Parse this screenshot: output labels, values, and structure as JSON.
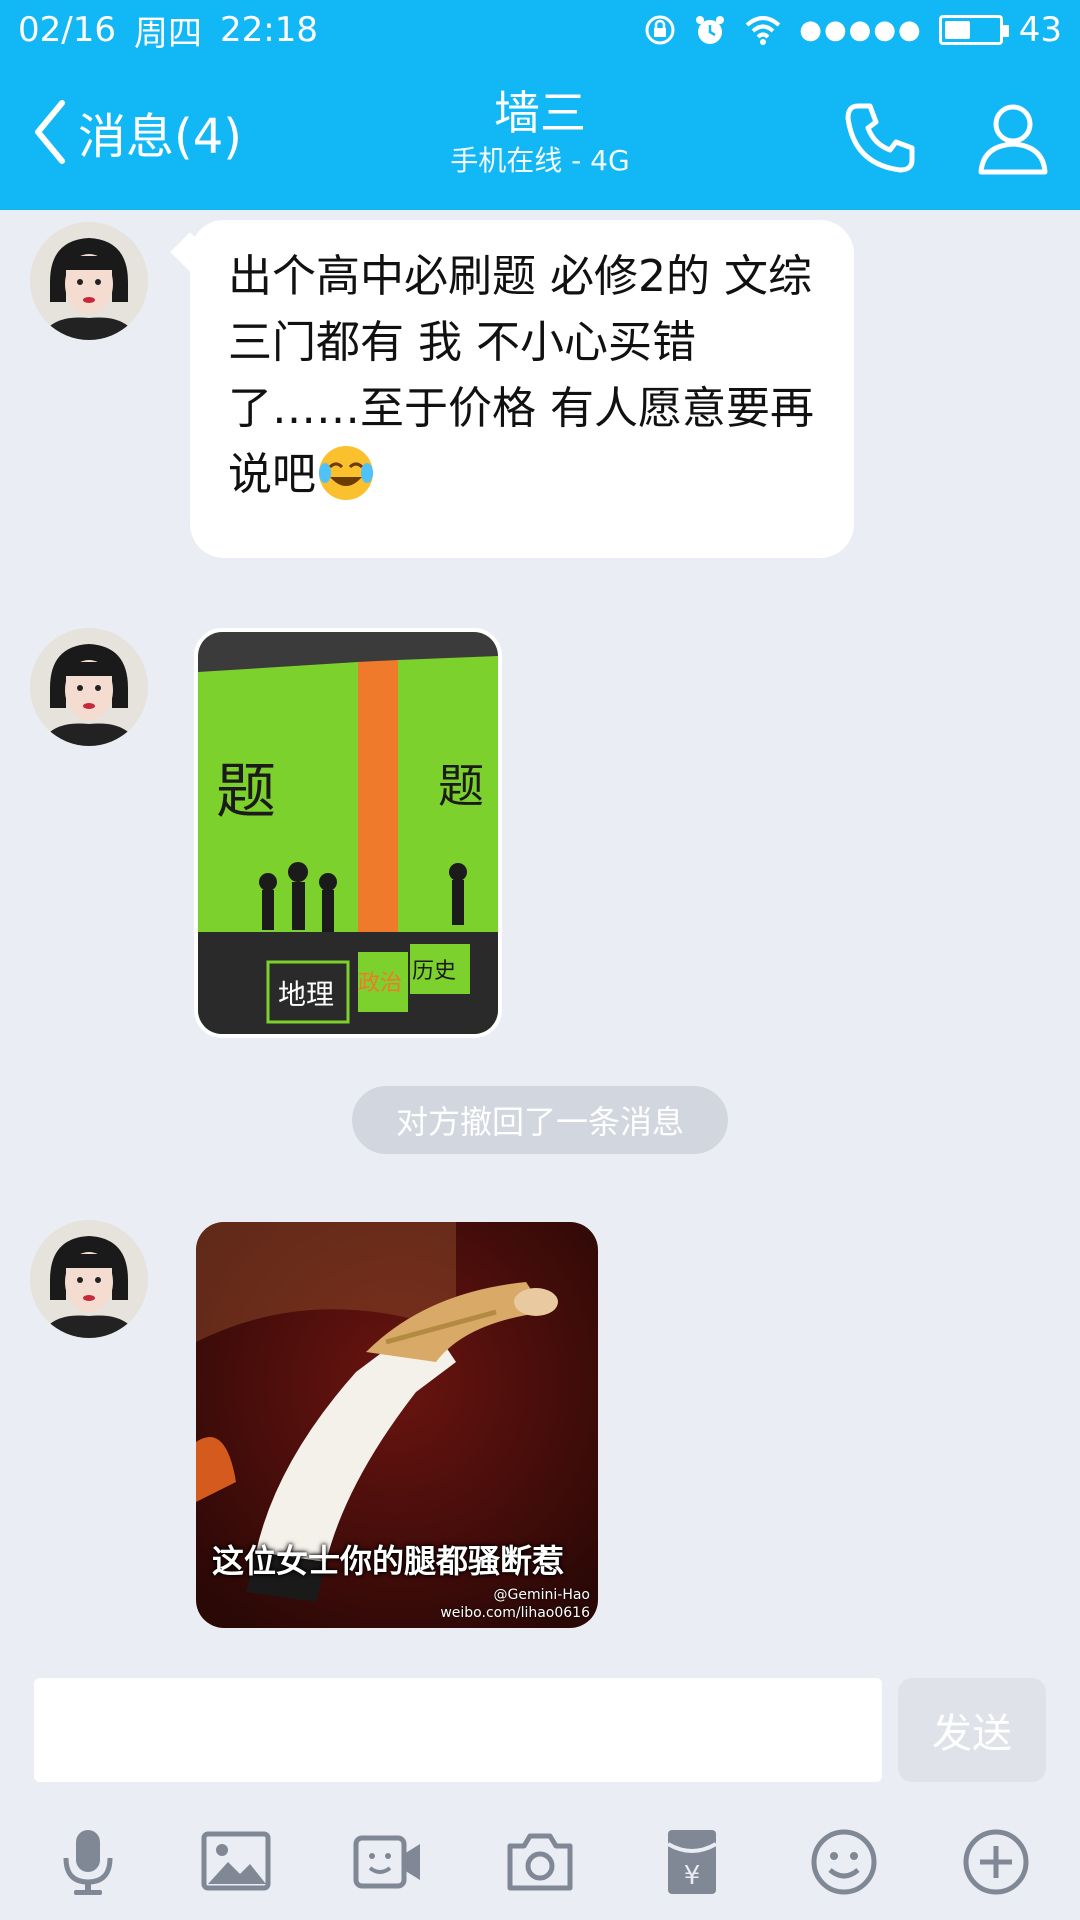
{
  "status_bar": {
    "date": "02/16",
    "weekday": "周四",
    "time": "22:18",
    "signal_dots": "●●●●●",
    "battery_level": "43",
    "battery_fraction": 0.43
  },
  "nav": {
    "back_label": "消息(4)",
    "title": "墙三",
    "subtitle": "手机在线 - 4G"
  },
  "messages": [
    {
      "type": "text",
      "text": "出个高中必刷题 必修2的 文综三门都有 我 不小心买错了……至于价格 有人愿意要再说吧",
      "emoji": "face-with-tears-of-joy"
    },
    {
      "type": "image",
      "content": "books-photo",
      "book_labels": [
        "地理",
        "政治",
        "历史"
      ],
      "cover_text": "题"
    },
    {
      "type": "system",
      "text": "对方撤回了一条消息"
    },
    {
      "type": "image",
      "content": "meme",
      "caption": "这位女士你的腿都骚断惹",
      "watermark_line1": "@Gemini-Hao",
      "watermark_line2": "weibo.com/lihao0616"
    }
  ],
  "input": {
    "value": "",
    "placeholder": "",
    "send_label": "发送"
  },
  "toolbar": [
    "microphone-icon",
    "image-icon",
    "video-call-icon",
    "camera-icon",
    "red-packet-icon",
    "emoji-icon",
    "plus-icon"
  ],
  "colors": {
    "header": "#12b7f5",
    "background": "#eaedf4",
    "bubble": "#ffffff",
    "icon": "#7f8894"
  }
}
